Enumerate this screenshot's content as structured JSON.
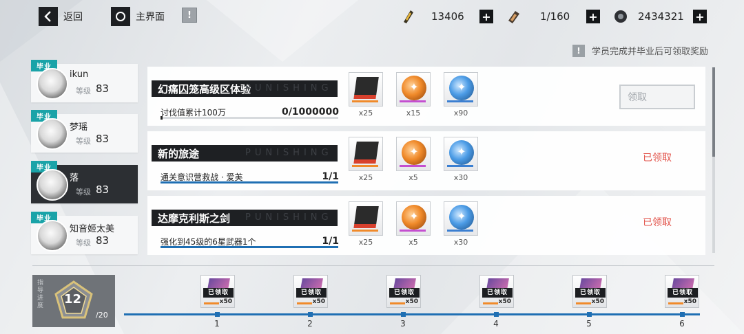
{
  "topbar": {
    "back_label": "返回",
    "home_label": "主界面",
    "resources": [
      {
        "icon": "stamina-ticket-icon",
        "value": "13406"
      },
      {
        "icon": "blood-pack-icon",
        "value": "1/160"
      },
      {
        "icon": "screw-gear-icon",
        "value": "2434321"
      }
    ]
  },
  "notice": "学员完成并毕业后可领取奖励",
  "students": [
    {
      "tag": "毕业",
      "name": "ikun",
      "level_label": "等级",
      "level": "83"
    },
    {
      "tag": "毕业",
      "name": "梦瑶",
      "level_label": "等级",
      "level": "83"
    },
    {
      "tag": "毕业",
      "name": "落",
      "level_label": "等级",
      "level": "83"
    },
    {
      "tag": "毕业",
      "name": "知音姬太美",
      "level_label": "等级",
      "level": "83"
    }
  ],
  "ghost_text": "PUNISHING",
  "tasks": [
    {
      "title": "幻痛囚笼高级区体验",
      "desc": "讨伐值累计100万",
      "progress": "0/1000000",
      "progress_ratio": 0,
      "rewards": [
        {
          "icon": "supply-chip-icon",
          "qty": "x25"
        },
        {
          "icon": "orange-coin-icon",
          "qty": "x15"
        },
        {
          "icon": "blue-coin-icon",
          "qty": "x90"
        }
      ],
      "status": "领取"
    },
    {
      "title": "新的旅途",
      "desc": "通关意识营救战 · 爱芙",
      "progress": "1/1",
      "progress_ratio": 1,
      "rewards": [
        {
          "icon": "supply-chip-icon",
          "qty": "x25"
        },
        {
          "icon": "orange-coin-icon",
          "qty": "x5"
        },
        {
          "icon": "blue-coin-icon",
          "qty": "x30"
        }
      ],
      "status": "已领取"
    },
    {
      "title": "达摩克利斯之剑",
      "desc": "强化到45级的6星武器1个",
      "progress": "1/1",
      "progress_ratio": 1,
      "rewards": [
        {
          "icon": "supply-chip-icon",
          "qty": "x25"
        },
        {
          "icon": "orange-coin-icon",
          "qty": "x5"
        },
        {
          "icon": "blue-coin-icon",
          "qty": "x30"
        }
      ],
      "status": "已领取"
    }
  ],
  "rank": {
    "label": "指导进度",
    "level": "12",
    "max": "/20"
  },
  "milestones": [
    {
      "num": "1",
      "status": "已领取",
      "count": "x50"
    },
    {
      "num": "2",
      "status": "已领取",
      "count": "x50"
    },
    {
      "num": "3",
      "status": "已领取",
      "count": "x50"
    },
    {
      "num": "4",
      "status": "已领取",
      "count": "x50"
    },
    {
      "num": "5",
      "status": "已领取",
      "count": "x50"
    },
    {
      "num": "6",
      "status": "已领取",
      "count": "x50"
    }
  ],
  "colors": {
    "accent_blue": "#1f6fb3",
    "claimed_red": "#e2534a",
    "graduate_teal": "#1aa3a8",
    "dark": "#1e2023"
  }
}
